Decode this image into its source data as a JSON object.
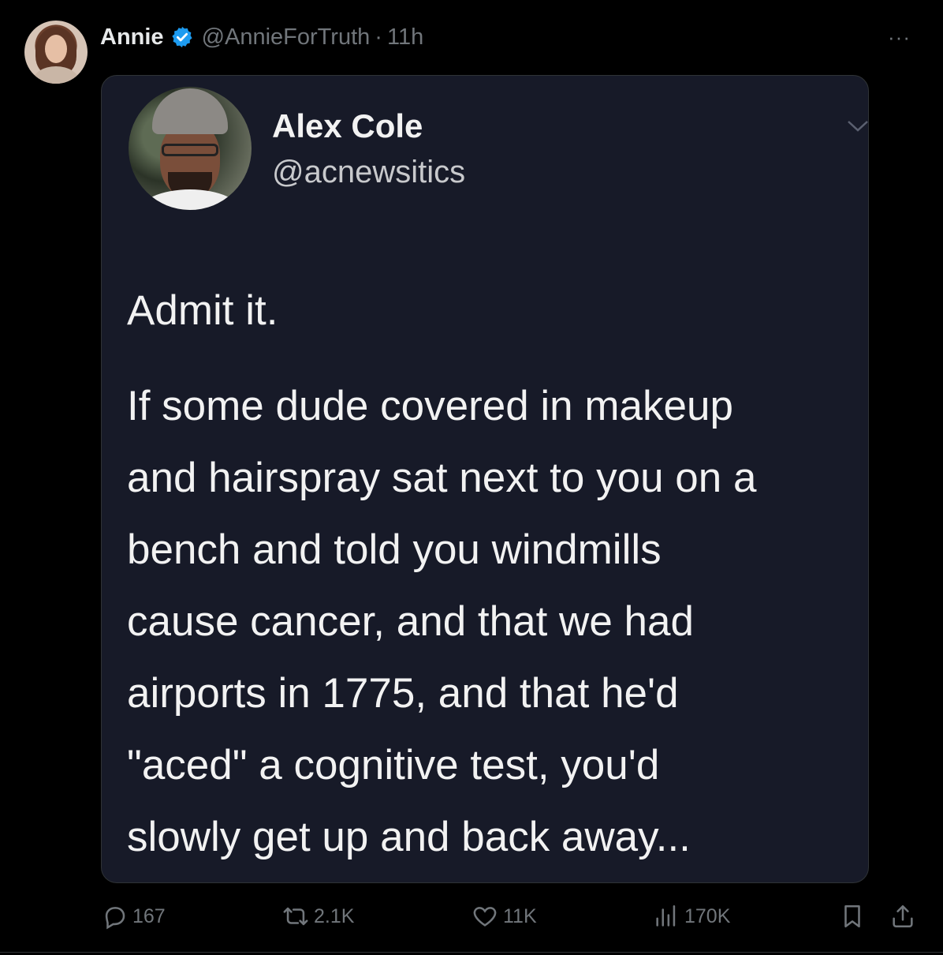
{
  "author": {
    "name": "Annie",
    "handle": "@AnnieForTruth",
    "separator": "·",
    "time": "11h",
    "verified_icon": "verified-badge-icon",
    "verified_color": "#1d9bf0"
  },
  "menu": {
    "more_label": "···"
  },
  "embedded": {
    "name": "Alex Cole",
    "handle": "@acnewsitics",
    "text_lead": "Admit it.",
    "text_body": "If some dude covered in makeup\nand hairspray sat next to you on a\nbench and told you windmills\ncause cancer, and that we had\nairports in 1775, and that he'd\n\"aced\" a cognitive test, you'd\nslowly get up and back away..."
  },
  "actions": {
    "replies": "167",
    "retweets": "2.1K",
    "likes": "11K",
    "views": "170K"
  }
}
